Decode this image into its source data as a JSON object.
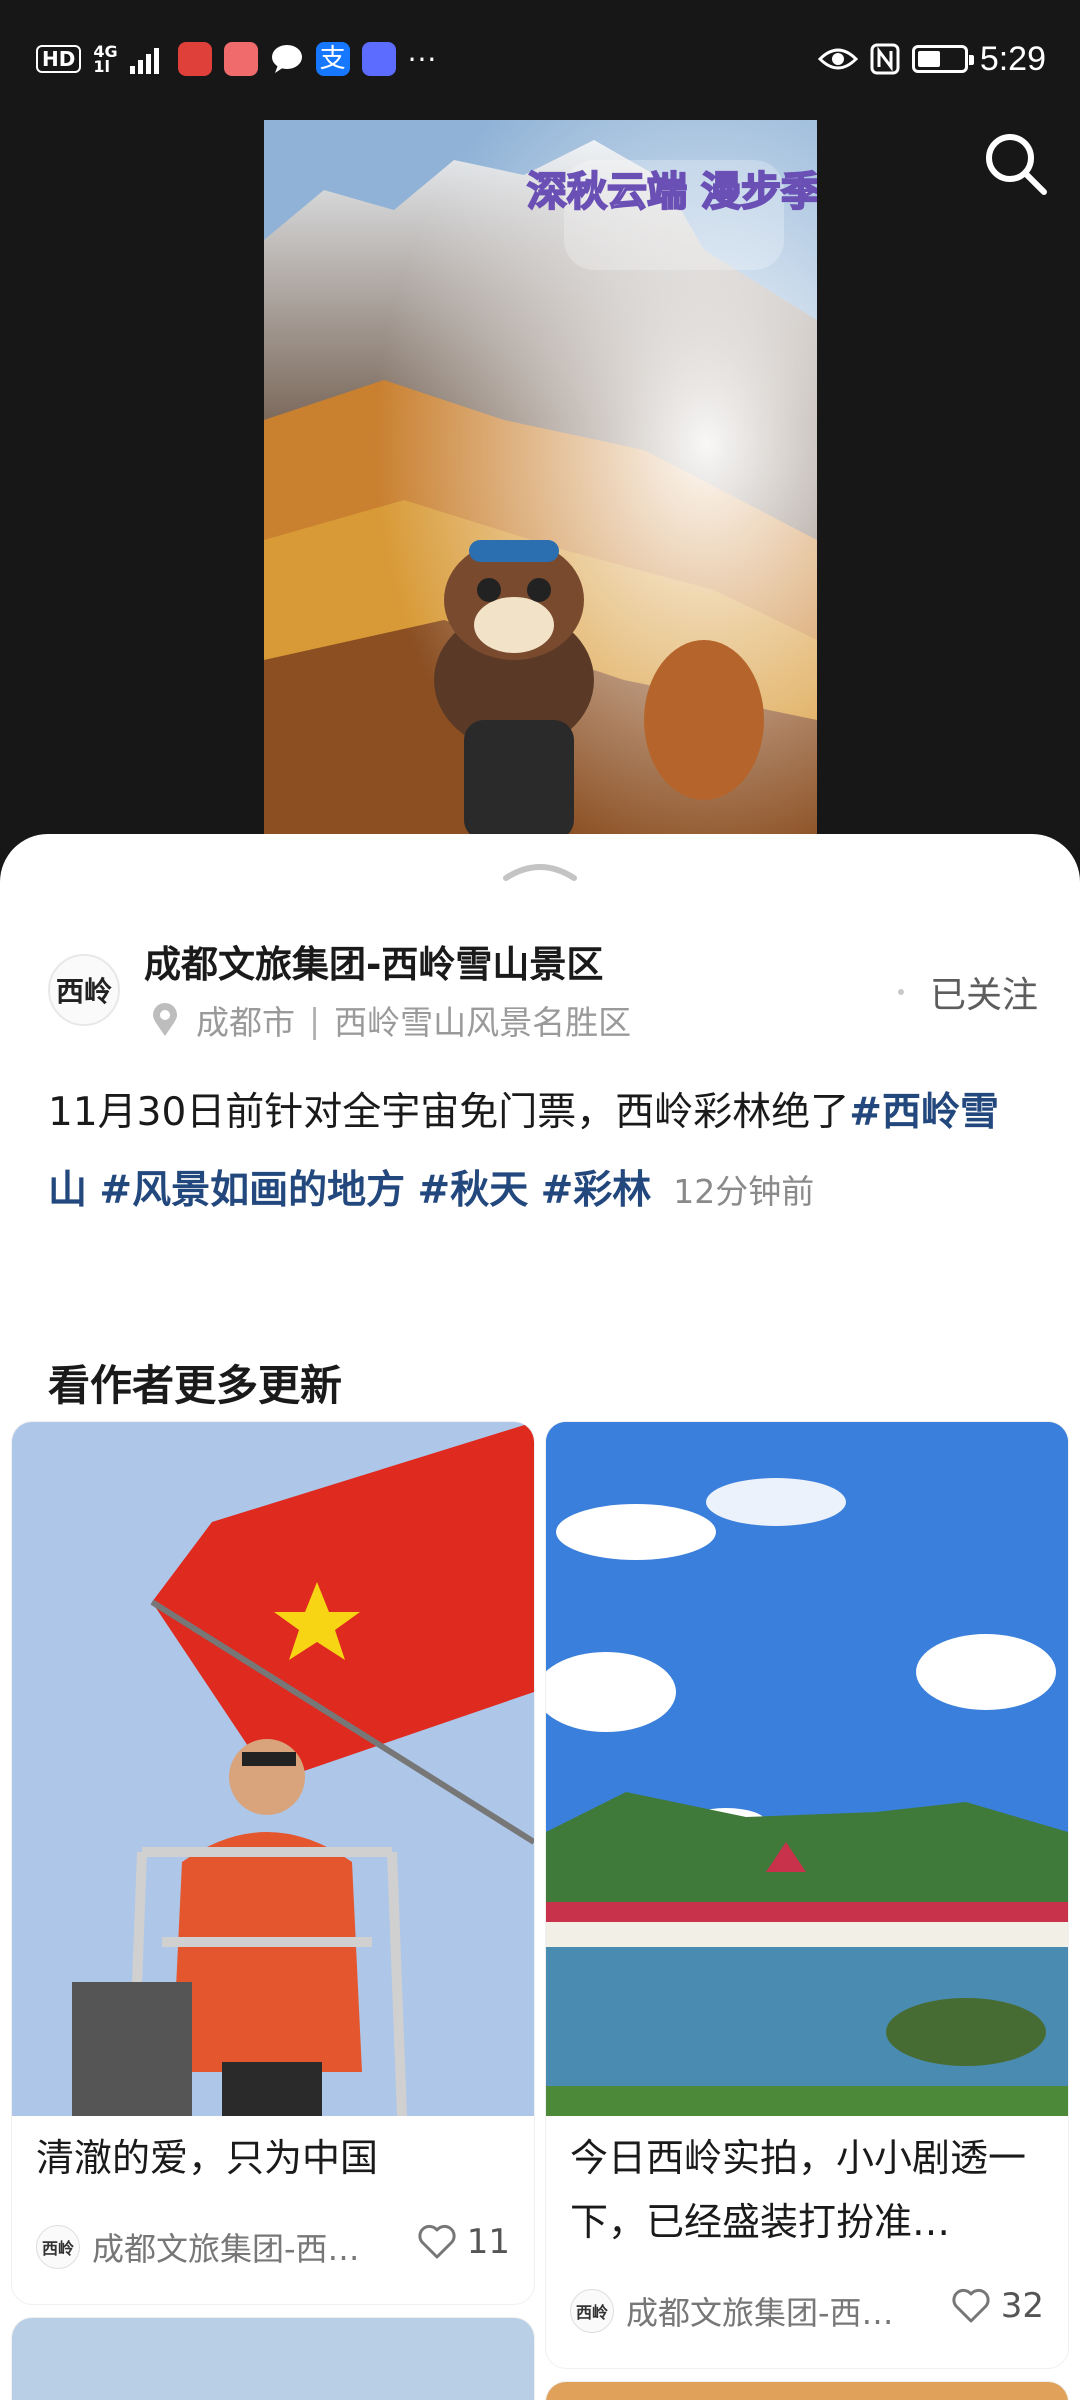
{
  "status_bar": {
    "hd": "HD",
    "network": "4G",
    "network_sub": "1l",
    "time": "5:29",
    "battery_level": 0.5,
    "icons": [
      "signal-icon",
      "weibo-app-icon",
      "app-icon",
      "message-icon",
      "alipay-icon",
      "music-icon",
      "more-dots-icon",
      "eye-icon",
      "nfc-icon",
      "battery-icon"
    ],
    "more": "···"
  },
  "hero": {
    "overlay_title": "深秋云端 漫步季"
  },
  "post": {
    "author_name": "成都文旅集团-西岭雪山景区",
    "avatar_text": "西岭",
    "location_city": "成都市",
    "location_place": "西岭雪山风景名胜区",
    "location_sep": "|",
    "follow_label": "已关注",
    "text": "11月30日前针对全宇宙免门票，西岭彩林绝了",
    "tags": [
      "#西岭雪山",
      "#风景如画的地方",
      "#秋天",
      "#彩林"
    ],
    "time_ago": "12分钟前"
  },
  "section": {
    "title": "看作者更多更新"
  },
  "cards": [
    {
      "title": "清澈的爱，只为中国",
      "author": "成都文旅集团-西…",
      "likes": "11"
    },
    {
      "title": "今日西岭实拍，小小剧透一下，已经盛装打扮准…",
      "author": "成都文旅集团-西…",
      "likes": "32"
    }
  ],
  "colors": {
    "tag": "#23487d",
    "background": "#171717"
  }
}
